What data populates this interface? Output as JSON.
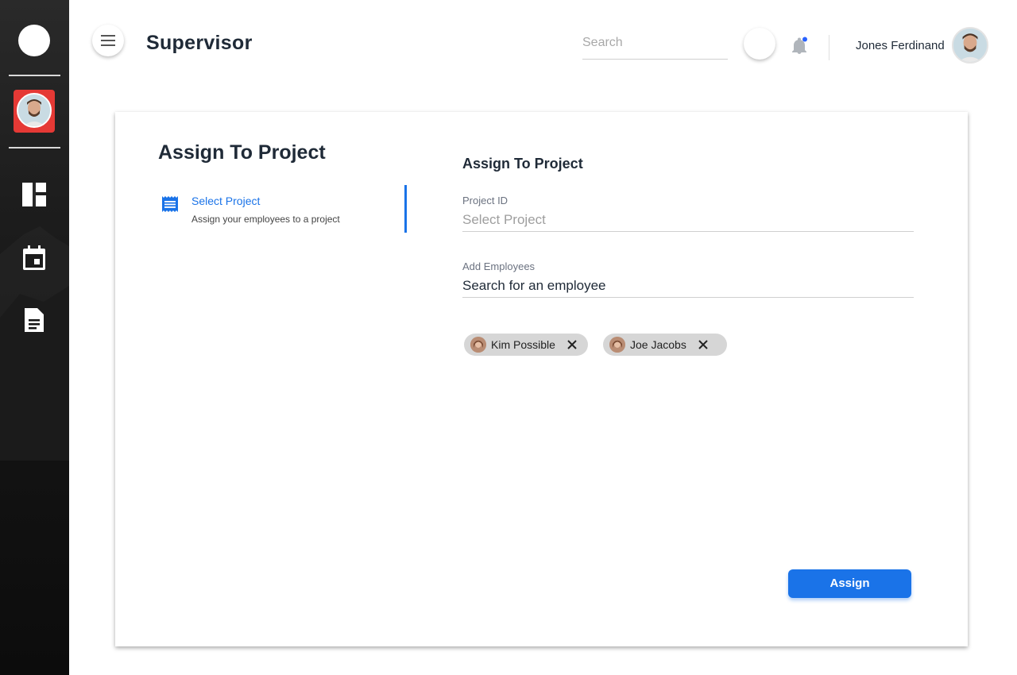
{
  "header": {
    "title": "Supervisor",
    "search_placeholder": "Search",
    "user_name": "Jones Ferdinand"
  },
  "card": {
    "title": "Assign To Project",
    "step": {
      "title": "Select Project",
      "subtitle": "Assign your employees to a project"
    },
    "form": {
      "title": "Assign To Project",
      "project_label": "Project ID",
      "project_placeholder": "Select Project",
      "employees_label": "Add Employees",
      "employees_value": "Search for an employee",
      "chips": [
        {
          "label": "Kim Possible"
        },
        {
          "label": "Joe Jacobs"
        }
      ],
      "assign_label": "Assign"
    }
  },
  "colors": {
    "accent": "#1a73e8",
    "avatar_highlight": "#e53935",
    "notification_dot": "#2962ff"
  },
  "icons": {
    "menu": "menu-icon",
    "dashboard": "dashboard-icon",
    "calendar": "calendar-icon",
    "document": "document-icon",
    "bell": "bell-icon",
    "step": "receipt-icon",
    "close": "close-icon"
  }
}
